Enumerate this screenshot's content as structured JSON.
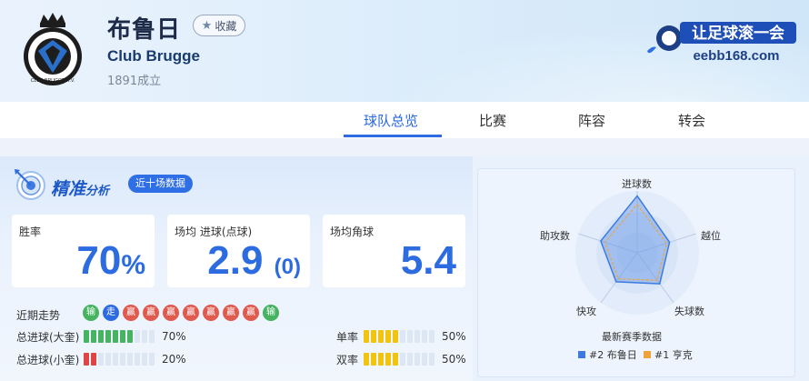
{
  "header": {
    "team_name_cn": "布鲁日",
    "favorite_label": "收藏",
    "team_name_en": "Club Brugge",
    "founded": "1891成立",
    "logo_text": "CLUB BRUGGE K.V.",
    "brand_text_top": "让足球滚一会",
    "brand_text_bottom": "eebb168.com"
  },
  "tabs": [
    {
      "label": "球队总览",
      "active": true
    },
    {
      "label": "比赛",
      "active": false
    },
    {
      "label": "阵容",
      "active": false
    },
    {
      "label": "转会",
      "active": false
    }
  ],
  "analysis": {
    "title_main": "精准",
    "title_small": "分析",
    "badge": "近十场数据",
    "stats": [
      {
        "label": "胜率",
        "value": "70",
        "unit": "%"
      },
      {
        "label": "场均 进球(点球)",
        "value": "2.9",
        "extra": "(0)"
      },
      {
        "label": "场均角球",
        "value": "5.4"
      }
    ],
    "recent_form_label": "近期走势",
    "recent_form": [
      {
        "text": "输",
        "type": "loss"
      },
      {
        "text": "走",
        "type": "draw"
      },
      {
        "text": "赢",
        "type": "win"
      },
      {
        "text": "赢",
        "type": "win"
      },
      {
        "text": "赢",
        "type": "win"
      },
      {
        "text": "赢",
        "type": "win"
      },
      {
        "text": "赢",
        "type": "win"
      },
      {
        "text": "赢",
        "type": "win"
      },
      {
        "text": "赢",
        "type": "win"
      },
      {
        "text": "输",
        "type": "loss"
      }
    ],
    "bars": [
      {
        "label": "总进球(大奎)",
        "value": "70%",
        "fraction": 0.7,
        "color": "g"
      },
      {
        "label": "总进球(小奎)",
        "value": "20%",
        "fraction": 0.2,
        "color": "r"
      },
      {
        "label": "单率",
        "value": "50%",
        "fraction": 0.5,
        "color": "y"
      },
      {
        "label": "双率",
        "value": "50%",
        "fraction": 0.5,
        "color": "y"
      }
    ]
  },
  "radar": {
    "axes": [
      "进球数",
      "越位",
      "失球数",
      "快攻",
      "助攻数"
    ],
    "caption": "最新赛季数据",
    "legend": [
      {
        "label": "#2 布鲁日",
        "color": "#3d7be0"
      },
      {
        "label": "#1 亨克",
        "color": "#f0a33a"
      }
    ],
    "series_a": [
      0.92,
      0.55,
      0.62,
      0.58,
      0.62
    ],
    "series_b": [
      0.78,
      0.5,
      0.55,
      0.52,
      0.55
    ]
  },
  "colors": {
    "accent": "#2c6be0",
    "win": "#e05a4e",
    "loss": "#45b360",
    "draw": "#2c6be0"
  }
}
